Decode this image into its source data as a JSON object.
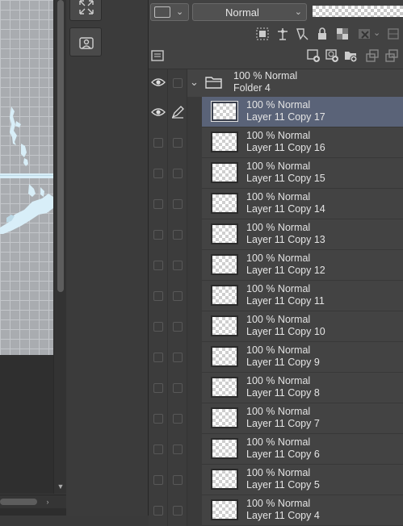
{
  "blend_bar": {
    "mode_label": "Normal"
  },
  "folder": {
    "mode": "100 % Normal",
    "name": "Folder 4"
  },
  "layers": [
    {
      "mode": "100 % Normal",
      "name": "Layer 11 Copy 17",
      "selected": true
    },
    {
      "mode": "100 % Normal",
      "name": "Layer 11 Copy 16"
    },
    {
      "mode": "100 % Normal",
      "name": "Layer 11 Copy 15"
    },
    {
      "mode": "100 % Normal",
      "name": "Layer 11 Copy 14"
    },
    {
      "mode": "100 % Normal",
      "name": "Layer 11 Copy 13"
    },
    {
      "mode": "100 % Normal",
      "name": "Layer 11 Copy 12"
    },
    {
      "mode": "100 % Normal",
      "name": "Layer 11 Copy 11"
    },
    {
      "mode": "100 % Normal",
      "name": "Layer 11 Copy 10"
    },
    {
      "mode": "100 % Normal",
      "name": "Layer 11 Copy 9"
    },
    {
      "mode": "100 % Normal",
      "name": "Layer 11 Copy 8"
    },
    {
      "mode": "100 % Normal",
      "name": "Layer 11 Copy 7"
    },
    {
      "mode": "100 % Normal",
      "name": "Layer 11 Copy 6"
    },
    {
      "mode": "100 % Normal",
      "name": "Layer 11 Copy 5"
    },
    {
      "mode": "100 % Normal",
      "name": "Layer 11 Copy 4"
    }
  ],
  "colors": {
    "panel_bg": "#424242",
    "selected_row": "#5a6378",
    "canvas_bg": "#a9acb0",
    "artwork": "#d8eef8"
  },
  "icons": {
    "visible": "eye-icon",
    "editing": "pencil-icon",
    "folder": "folder-icon"
  }
}
